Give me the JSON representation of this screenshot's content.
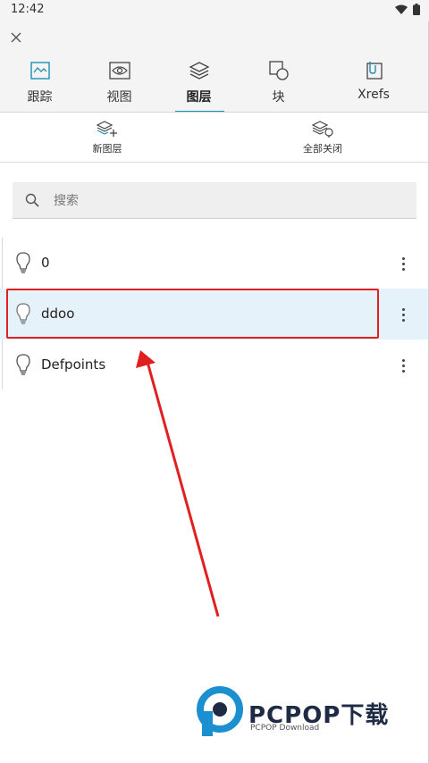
{
  "status_bar": {
    "time": "12:42"
  },
  "tabs": [
    {
      "label": "跟踪",
      "icon": "trace-icon"
    },
    {
      "label": "视图",
      "icon": "view-icon"
    },
    {
      "label": "图层",
      "icon": "layers-icon",
      "active": true
    },
    {
      "label": "块",
      "icon": "block-icon"
    },
    {
      "label": "Xrefs",
      "icon": "xrefs-icon"
    }
  ],
  "toolbar": {
    "new_layer_label": "新图层",
    "close_all_label": "全部关闭"
  },
  "search": {
    "placeholder": "搜索"
  },
  "layers": [
    {
      "name": "0",
      "selected": false
    },
    {
      "name": "ddoo",
      "selected": true
    },
    {
      "name": "Defpoints",
      "selected": false
    }
  ],
  "watermark": {
    "text": "PCPOP下载",
    "subtext": "PCPOP Download"
  },
  "colors": {
    "accent": "#1a8fb8",
    "annotation": "#e02020",
    "selected_row": "#e6f2f9"
  }
}
